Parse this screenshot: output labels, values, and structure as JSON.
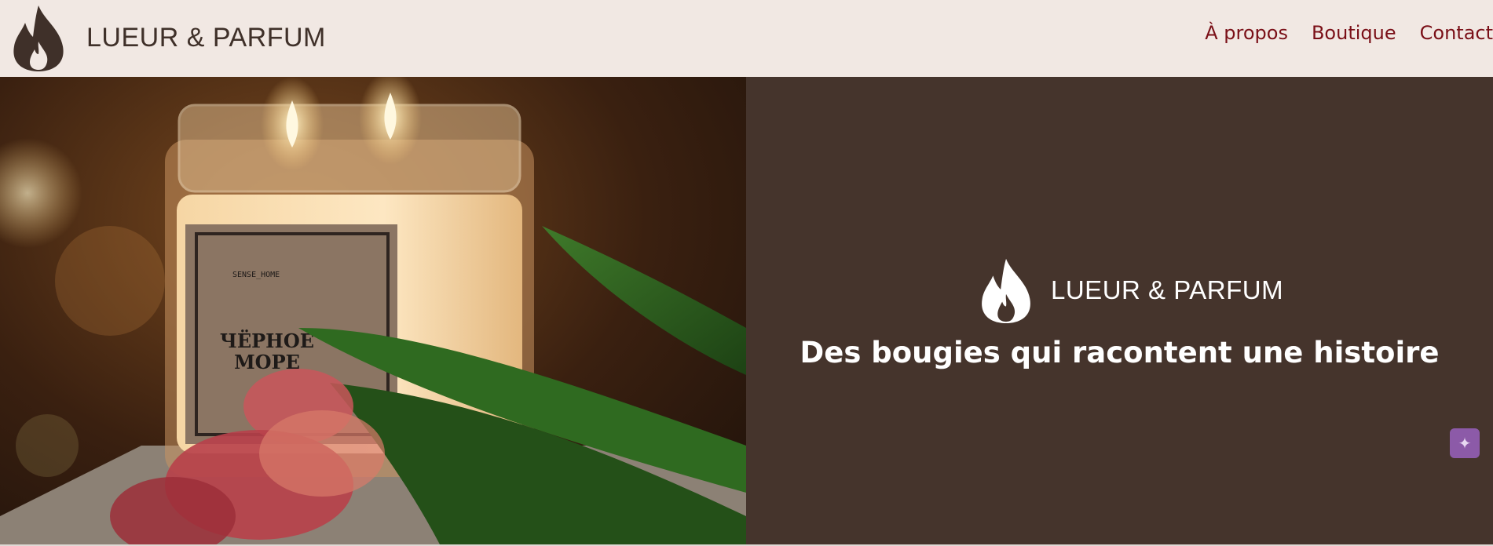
{
  "brand": {
    "name": "LUEUR & PARFUM",
    "color": "#3f3029",
    "icon": "flame-icon"
  },
  "nav": {
    "items": [
      {
        "label": "À propos"
      },
      {
        "label": "Boutique"
      },
      {
        "label": "Contact"
      }
    ],
    "color": "#7a0f17"
  },
  "hero": {
    "image": {
      "label": "ЧЁРНОЕ МОРЕ",
      "brand": "SENSE_HOME",
      "icon": "candle-photo"
    },
    "logo_name": "LUEUR & PARFUM",
    "tagline": "Des bougies qui racontent une histoire",
    "panel_color": "#45342c"
  },
  "assistant": {
    "icon": "sparkle-icon",
    "color": "#8c5aa8"
  }
}
